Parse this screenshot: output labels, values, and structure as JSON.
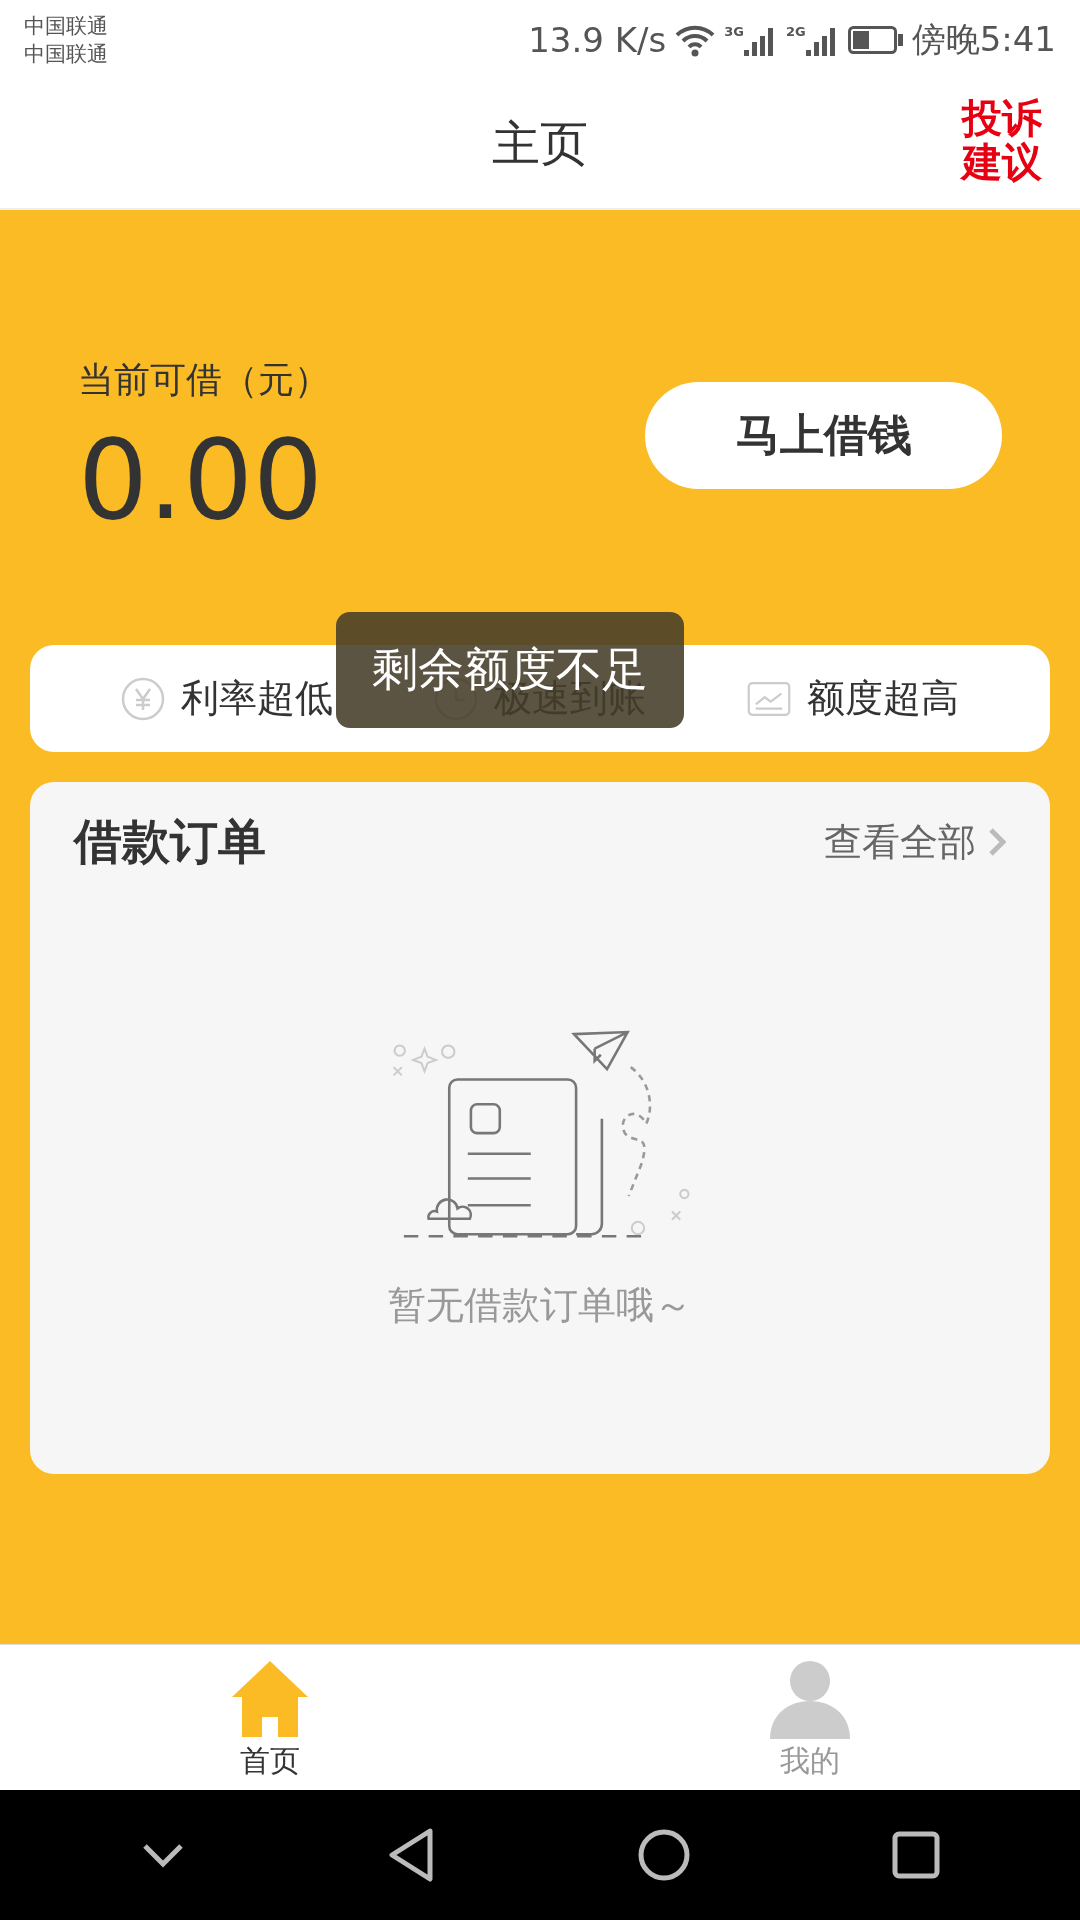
{
  "status_bar": {
    "carriers": [
      "中国联通",
      "中国联通"
    ],
    "speed": "13.9 K/s",
    "network_1": "3G",
    "network_2": "2G",
    "time": "傍晚5:41"
  },
  "header": {
    "title": "主页",
    "action": "投诉建议"
  },
  "balance": {
    "label": "当前可借（元）",
    "amount": "0.00",
    "button": "马上借钱"
  },
  "features": [
    {
      "kind": "rate",
      "label": "利率超低"
    },
    {
      "kind": "speed",
      "label": "极速到账"
    },
    {
      "kind": "limit",
      "label": "额度超高"
    }
  ],
  "toast": "剩余额度不足",
  "orders": {
    "title": "借款订单",
    "link": "查看全部",
    "empty_text": "暂无借款订单哦～"
  },
  "tabs": [
    {
      "kind": "home",
      "label": "首页",
      "selected": true
    },
    {
      "kind": "profile",
      "label": "我的",
      "selected": false
    }
  ]
}
